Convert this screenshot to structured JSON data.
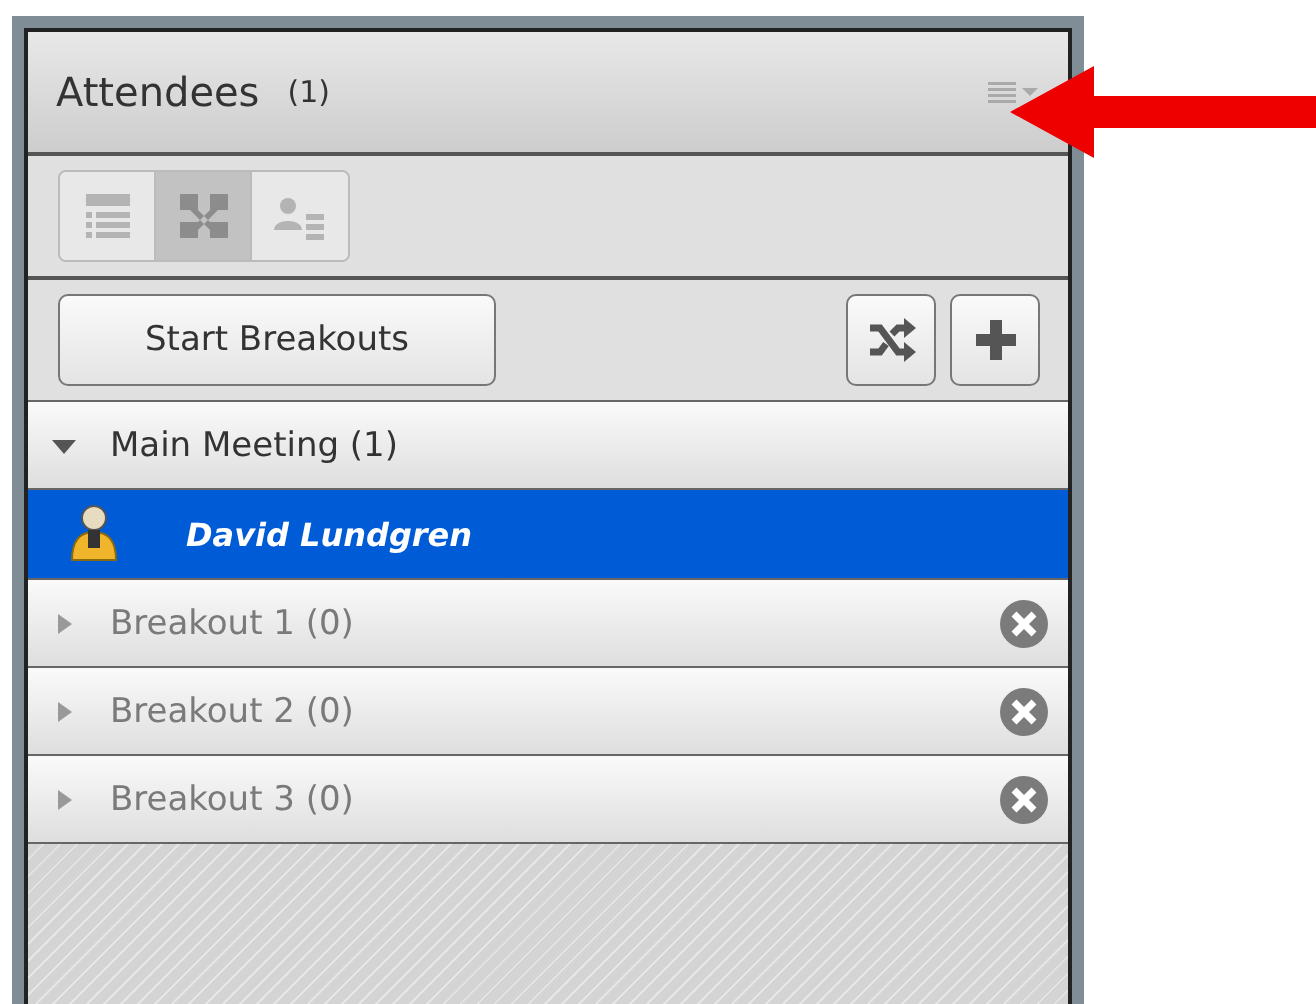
{
  "panel": {
    "title": "Attendees",
    "count": "(1)"
  },
  "view_buttons": [
    {
      "kind": "list",
      "selected": false
    },
    {
      "kind": "breakout",
      "selected": true
    },
    {
      "kind": "detail",
      "selected": false
    }
  ],
  "start_button": "Start Breakouts",
  "rooms": [
    {
      "name": "Main Meeting (1)",
      "expanded": true,
      "removable": false,
      "attendees": [
        {
          "name": "David Lundgren",
          "selected": true
        }
      ]
    },
    {
      "name": "Breakout 1 (0)",
      "expanded": false,
      "removable": true
    },
    {
      "name": "Breakout 2 (0)",
      "expanded": false,
      "removable": true
    },
    {
      "name": "Breakout 3 (0)",
      "expanded": false,
      "removable": true
    }
  ]
}
